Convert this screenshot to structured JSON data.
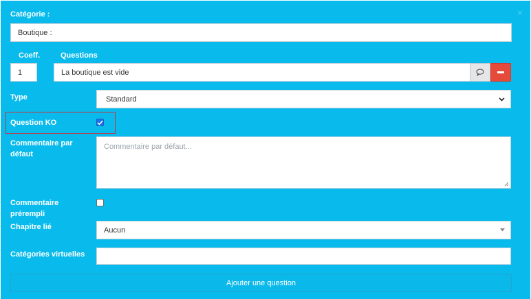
{
  "form": {
    "close_symbol": "×",
    "category": {
      "label": "Catégorie :",
      "value": "Boutique :"
    },
    "coeff": {
      "label": "Coeff.",
      "value": "1"
    },
    "questions": {
      "label": "Questions",
      "value": "La boutique est vide"
    },
    "type": {
      "label": "Type",
      "value": "Standard"
    },
    "question_ko": {
      "label": "Question KO",
      "checked": true
    },
    "default_comment": {
      "label_line1": "Commentaire par",
      "label_line2": "défaut",
      "placeholder": "Commentaire par défaut..."
    },
    "prefilled_comment": {
      "label_line1": "Commentaire",
      "label_line2": "prérempli",
      "checked": false
    },
    "linked_chapter": {
      "label": "Chapitre lié",
      "value": "Aucun"
    },
    "virtual_categories": {
      "label": "Catégories virtuelles",
      "value": ""
    },
    "add_button": "Ajouter une question"
  },
  "icons": {
    "comment": "comment-icon",
    "remove": "minus-icon",
    "close": "close-icon"
  },
  "colors": {
    "panel_bg": "#08bbec",
    "danger": "#e64a3b",
    "highlight_border": "#c8323a",
    "checkbox_on": "#1a73e8"
  }
}
